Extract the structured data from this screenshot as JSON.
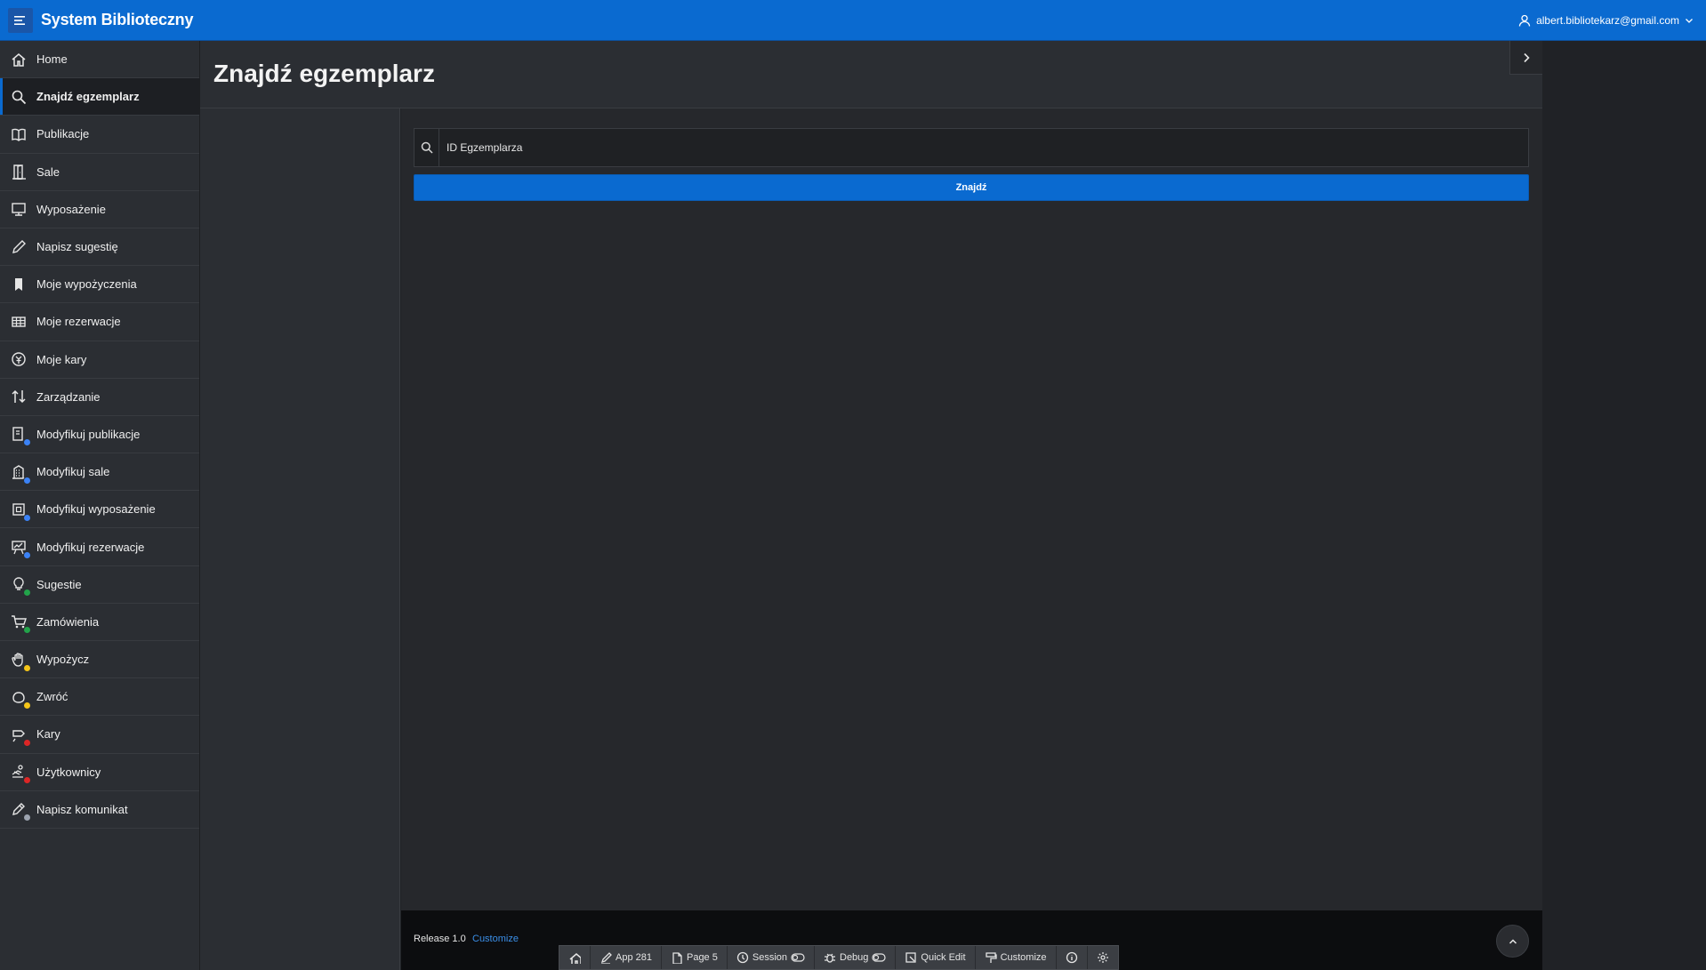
{
  "header": {
    "app_title": "System Biblioteczny",
    "user_email": "albert.bibliotekarz@gmail.com",
    "menu_icon": "hamburger-icon",
    "user_icon": "user-icon"
  },
  "sidebar": {
    "items": [
      {
        "label": "Home",
        "icon": "home-icon"
      },
      {
        "label": "Znajdź egzemplarz",
        "icon": "search-icon",
        "active": true
      },
      {
        "label": "Publikacje",
        "icon": "book-open-icon"
      },
      {
        "label": "Sale",
        "icon": "door-icon"
      },
      {
        "label": "Wyposażenie",
        "icon": "monitor-icon"
      },
      {
        "label": "Napisz sugestię",
        "icon": "pencil-icon"
      },
      {
        "label": "Moje wypożyczenia",
        "icon": "bookmark-icon"
      },
      {
        "label": "Moje rezerwacje",
        "icon": "table-icon"
      },
      {
        "label": "Moje kary",
        "icon": "coin-icon"
      },
      {
        "label": "Zarządzanie",
        "icon": "sort-arrows-icon"
      },
      {
        "label": "Modyfikuj publikacje",
        "icon": "book-edit-icon",
        "badge": "#3b82f6"
      },
      {
        "label": "Modyfikuj sale",
        "icon": "building-edit-icon",
        "badge": "#3b82f6"
      },
      {
        "label": "Modyfikuj wyposażenie",
        "icon": "chip-edit-icon",
        "badge": "#3b82f6"
      },
      {
        "label": "Modyfikuj rezerwacje",
        "icon": "presentation-edit-icon",
        "badge": "#3b82f6"
      },
      {
        "label": "Sugestie",
        "icon": "lightbulb-icon",
        "badge": "#22a34a"
      },
      {
        "label": "Zamówienia",
        "icon": "cart-icon",
        "badge": "#22a34a"
      },
      {
        "label": "Wypożycz",
        "icon": "hand-icon",
        "badge": "#f5c518"
      },
      {
        "label": "Zwróć",
        "icon": "return-hand-icon",
        "badge": "#f5c518"
      },
      {
        "label": "Kary",
        "icon": "fine-icon",
        "badge": "#dc2626"
      },
      {
        "label": "Użytkownicy",
        "icon": "users-icon",
        "badge": "#dc2626"
      },
      {
        "label": "Napisz komunikat",
        "icon": "pen-message-icon",
        "badge": "#9ca3af"
      }
    ]
  },
  "page": {
    "title": "Znajdź egzemplarz",
    "search_placeholder": "ID Egzemplarza",
    "find_button": "Znajdź"
  },
  "footer": {
    "release": "Release 1.0",
    "customize": "Customize"
  },
  "devbar": {
    "items": [
      {
        "label": "",
        "icon": "home-icon"
      },
      {
        "label": "App 281",
        "icon": "edit-icon"
      },
      {
        "label": "Page 5",
        "icon": "page-edit-icon"
      },
      {
        "label": "Session",
        "icon": "session-icon",
        "toggle": true
      },
      {
        "label": "Debug",
        "icon": "bug-icon",
        "toggle": true
      },
      {
        "label": "Quick Edit",
        "icon": "quick-edit-icon"
      },
      {
        "label": "Customize",
        "icon": "paint-roller-icon"
      },
      {
        "label": "",
        "icon": "info-icon"
      },
      {
        "label": "",
        "icon": "gear-icon"
      }
    ]
  },
  "colors": {
    "accent": "#0a6ad0",
    "header_bg": "#0a6ad0",
    "sidebar_bg": "#2b2e33",
    "content_bg": "#26282c"
  }
}
